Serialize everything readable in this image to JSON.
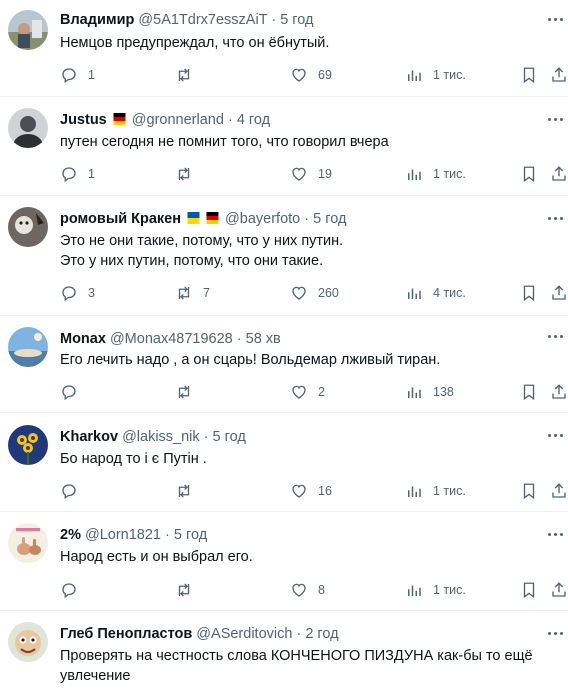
{
  "tweets": [
    {
      "name": "Владимир",
      "handle": "@5A1Tdrx7esszAiT",
      "time": "5 год",
      "lines": [
        "Немцов предупреждал, что он ёбнутый."
      ],
      "replies": "1",
      "retweets": "",
      "likes": "69",
      "views": "1 тис."
    },
    {
      "name": "Justus",
      "handle": "@gronnerland",
      "time": "4 год",
      "lines": [
        "путен сегодня не помнит того, что говорил вчера"
      ],
      "replies": "1",
      "retweets": "",
      "likes": "19",
      "views": "1 тис."
    },
    {
      "name": "ромовый Кракен",
      "handle": "@bayerfoto",
      "time": "5 год",
      "lines": [
        "Это не они такие, потому, что у них путин.",
        "Это у них путин, потому, что они такие."
      ],
      "replies": "3",
      "retweets": "7",
      "likes": "260",
      "views": "4 тис."
    },
    {
      "name": "Monax",
      "handle": "@Monax48719628",
      "time": "58 хв",
      "lines": [
        "Его лечить надо , а он сцарь! Вольдемар лживый тиран."
      ],
      "replies": "",
      "retweets": "",
      "likes": "2",
      "views": "138"
    },
    {
      "name": "Kharkov",
      "handle": "@lakiss_nik",
      "time": "5 год",
      "lines": [
        "Бо народ то і є Путін ."
      ],
      "replies": "",
      "retweets": "",
      "likes": "16",
      "views": "1 тис."
    },
    {
      "name": "2%",
      "handle": "@Lorn1821",
      "time": "5 год",
      "lines": [
        "Народ есть и он выбрал его."
      ],
      "replies": "",
      "retweets": "",
      "likes": "8",
      "views": "1 тис."
    },
    {
      "name": "Глеб Пенопластов",
      "handle": "@ASerditovich",
      "time": "2 год",
      "lines": [
        "Проверять на честность слова КОНЧЕНОГО ПИЗДУНА как-бы то ещё",
        "увлечение"
      ],
      "replies": "",
      "retweets": "",
      "likes": "",
      "views": ""
    }
  ],
  "separator": "·",
  "icons": {
    "reply": "reply-icon",
    "retweet": "retweet-icon",
    "like": "heart-icon",
    "views": "views-icon",
    "bookmark": "bookmark-icon",
    "share": "share-icon",
    "more": "more-icon"
  },
  "flags": {
    "germany": [
      "#000000",
      "#dd0000",
      "#ffce00"
    ],
    "ukraine": [
      "#0057b7",
      "#ffd700"
    ]
  },
  "colors": {
    "text": "#0f1419",
    "secondary": "#536471",
    "divider": "#eff3f4"
  }
}
